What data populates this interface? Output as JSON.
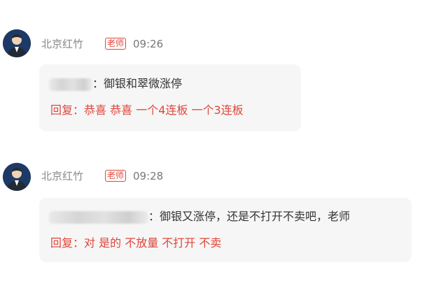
{
  "messages": [
    {
      "author": "北京红竹",
      "role_badge": "老师",
      "time": "09:26",
      "quote_separator": "：",
      "quote_text": "御银和翠微涨停",
      "reply_prefix": "回复：",
      "reply_text": "恭喜 恭喜 一个4连板 一个3连板"
    },
    {
      "author": "北京红竹",
      "role_badge": "老师",
      "time": "09:28",
      "quote_separator": "：",
      "quote_text": "御银又涨停，还是不打开不卖吧，老师",
      "reply_prefix": "回复：",
      "reply_text": "对 是的 不放量 不打开 不卖"
    }
  ],
  "colors": {
    "accent_red": "#e0463a",
    "bubble_bg": "#f6f6f6",
    "avatar_bg": "#1d3a66"
  },
  "icons": {
    "avatar": "avatar-portrait"
  }
}
